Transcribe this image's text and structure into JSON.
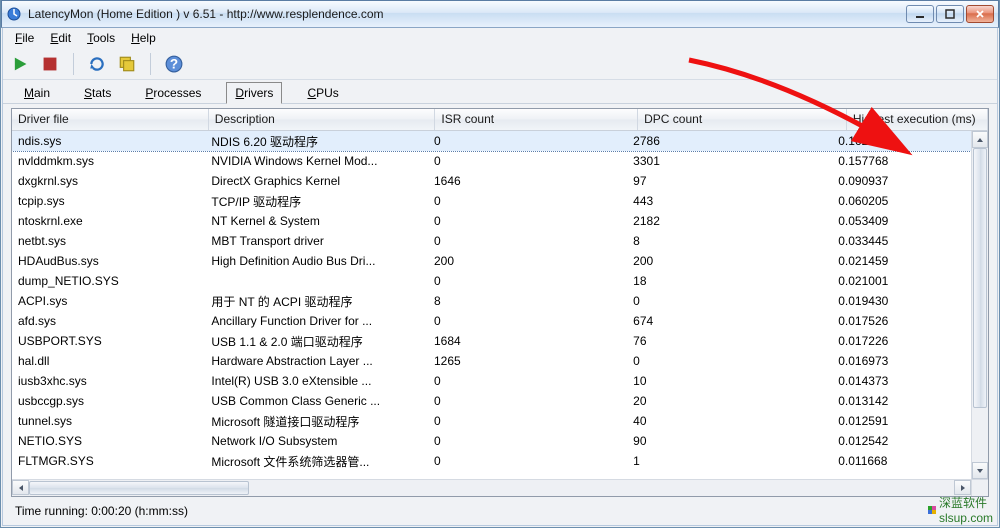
{
  "window": {
    "title": "LatencyMon  (Home Edition )   v 6.51 - http://www.resplendence.com"
  },
  "menubar": {
    "file_accel": "F",
    "file_rest": "ile",
    "edit_accel": "E",
    "edit_rest": "dit",
    "tools_accel": "T",
    "tools_rest": "ools",
    "help_accel": "H",
    "help_rest": "elp"
  },
  "tabs": [
    {
      "accel": "M",
      "rest": "ain"
    },
    {
      "accel": "S",
      "rest": "tats"
    },
    {
      "accel": "P",
      "rest": "rocesses"
    },
    {
      "accel": "D",
      "rest": "rivers"
    },
    {
      "accel": "C",
      "rest": "PUs"
    }
  ],
  "columns": [
    "Driver file",
    "Description",
    "ISR count",
    "DPC count",
    "Highest execution (ms)"
  ],
  "rows": [
    {
      "file": "ndis.sys",
      "desc": "NDIS 6.20 驱动程序",
      "isr": "0",
      "dpc": "2786",
      "hi": "0.162918",
      "selected": true
    },
    {
      "file": "nvlddmkm.sys",
      "desc": "NVIDIA Windows Kernel Mod...",
      "isr": "0",
      "dpc": "3301",
      "hi": "0.157768"
    },
    {
      "file": "dxgkrnl.sys",
      "desc": "DirectX Graphics Kernel",
      "isr": "1646",
      "dpc": "97",
      "hi": "0.090937"
    },
    {
      "file": "tcpip.sys",
      "desc": "TCP/IP 驱动程序",
      "isr": "0",
      "dpc": "443",
      "hi": "0.060205"
    },
    {
      "file": "ntoskrnl.exe",
      "desc": "NT Kernel & System",
      "isr": "0",
      "dpc": "2182",
      "hi": "0.053409"
    },
    {
      "file": "netbt.sys",
      "desc": "MBT Transport driver",
      "isr": "0",
      "dpc": "8",
      "hi": "0.033445"
    },
    {
      "file": "HDAudBus.sys",
      "desc": "High Definition Audio Bus Dri...",
      "isr": "200",
      "dpc": "200",
      "hi": "0.021459"
    },
    {
      "file": "dump_NETIO.SYS",
      "desc": "",
      "isr": "0",
      "dpc": "18",
      "hi": "0.021001"
    },
    {
      "file": "ACPI.sys",
      "desc": "用于 NT 的 ACPI 驱动程序",
      "isr": "8",
      "dpc": "0",
      "hi": "0.019430"
    },
    {
      "file": "afd.sys",
      "desc": "Ancillary Function Driver for ...",
      "isr": "0",
      "dpc": "674",
      "hi": "0.017526"
    },
    {
      "file": "USBPORT.SYS",
      "desc": "USB 1.1 & 2.0 端口驱动程序",
      "isr": "1684",
      "dpc": "76",
      "hi": "0.017226"
    },
    {
      "file": "hal.dll",
      "desc": "Hardware Abstraction Layer ...",
      "isr": "1265",
      "dpc": "0",
      "hi": "0.016973"
    },
    {
      "file": "iusb3xhc.sys",
      "desc": "Intel(R) USB 3.0 eXtensible ...",
      "isr": "0",
      "dpc": "10",
      "hi": "0.014373"
    },
    {
      "file": "usbccgp.sys",
      "desc": "USB Common Class Generic ...",
      "isr": "0",
      "dpc": "20",
      "hi": "0.013142"
    },
    {
      "file": "tunnel.sys",
      "desc": "Microsoft 隧道接口驱动程序",
      "isr": "0",
      "dpc": "40",
      "hi": "0.012591"
    },
    {
      "file": "NETIO.SYS",
      "desc": "Network I/O Subsystem",
      "isr": "0",
      "dpc": "90",
      "hi": "0.012542"
    },
    {
      "file": "FLTMGR.SYS",
      "desc": "Microsoft 文件系统筛选器管...",
      "isr": "0",
      "dpc": "1",
      "hi": "0.011668"
    }
  ],
  "status": {
    "text": "Time running: 0:00:20  (h:mm:ss)"
  },
  "watermark": {
    "line1": "深蓝软件",
    "line2": "slsup.com"
  }
}
